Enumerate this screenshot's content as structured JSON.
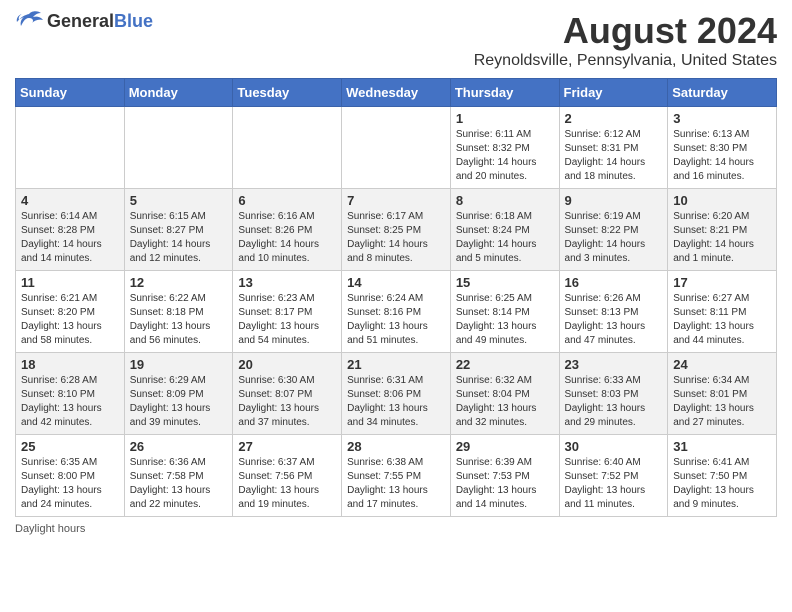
{
  "logo": {
    "general": "General",
    "blue": "Blue"
  },
  "title": "August 2024",
  "location": "Reynoldsville, Pennsylvania, United States",
  "days_of_week": [
    "Sunday",
    "Monday",
    "Tuesday",
    "Wednesday",
    "Thursday",
    "Friday",
    "Saturday"
  ],
  "weeks": [
    [
      {
        "day": "",
        "info": ""
      },
      {
        "day": "",
        "info": ""
      },
      {
        "day": "",
        "info": ""
      },
      {
        "day": "",
        "info": ""
      },
      {
        "day": "1",
        "info": "Sunrise: 6:11 AM\nSunset: 8:32 PM\nDaylight: 14 hours and 20 minutes."
      },
      {
        "day": "2",
        "info": "Sunrise: 6:12 AM\nSunset: 8:31 PM\nDaylight: 14 hours and 18 minutes."
      },
      {
        "day": "3",
        "info": "Sunrise: 6:13 AM\nSunset: 8:30 PM\nDaylight: 14 hours and 16 minutes."
      }
    ],
    [
      {
        "day": "4",
        "info": "Sunrise: 6:14 AM\nSunset: 8:28 PM\nDaylight: 14 hours and 14 minutes."
      },
      {
        "day": "5",
        "info": "Sunrise: 6:15 AM\nSunset: 8:27 PM\nDaylight: 14 hours and 12 minutes."
      },
      {
        "day": "6",
        "info": "Sunrise: 6:16 AM\nSunset: 8:26 PM\nDaylight: 14 hours and 10 minutes."
      },
      {
        "day": "7",
        "info": "Sunrise: 6:17 AM\nSunset: 8:25 PM\nDaylight: 14 hours and 8 minutes."
      },
      {
        "day": "8",
        "info": "Sunrise: 6:18 AM\nSunset: 8:24 PM\nDaylight: 14 hours and 5 minutes."
      },
      {
        "day": "9",
        "info": "Sunrise: 6:19 AM\nSunset: 8:22 PM\nDaylight: 14 hours and 3 minutes."
      },
      {
        "day": "10",
        "info": "Sunrise: 6:20 AM\nSunset: 8:21 PM\nDaylight: 14 hours and 1 minute."
      }
    ],
    [
      {
        "day": "11",
        "info": "Sunrise: 6:21 AM\nSunset: 8:20 PM\nDaylight: 13 hours and 58 minutes."
      },
      {
        "day": "12",
        "info": "Sunrise: 6:22 AM\nSunset: 8:18 PM\nDaylight: 13 hours and 56 minutes."
      },
      {
        "day": "13",
        "info": "Sunrise: 6:23 AM\nSunset: 8:17 PM\nDaylight: 13 hours and 54 minutes."
      },
      {
        "day": "14",
        "info": "Sunrise: 6:24 AM\nSunset: 8:16 PM\nDaylight: 13 hours and 51 minutes."
      },
      {
        "day": "15",
        "info": "Sunrise: 6:25 AM\nSunset: 8:14 PM\nDaylight: 13 hours and 49 minutes."
      },
      {
        "day": "16",
        "info": "Sunrise: 6:26 AM\nSunset: 8:13 PM\nDaylight: 13 hours and 47 minutes."
      },
      {
        "day": "17",
        "info": "Sunrise: 6:27 AM\nSunset: 8:11 PM\nDaylight: 13 hours and 44 minutes."
      }
    ],
    [
      {
        "day": "18",
        "info": "Sunrise: 6:28 AM\nSunset: 8:10 PM\nDaylight: 13 hours and 42 minutes."
      },
      {
        "day": "19",
        "info": "Sunrise: 6:29 AM\nSunset: 8:09 PM\nDaylight: 13 hours and 39 minutes."
      },
      {
        "day": "20",
        "info": "Sunrise: 6:30 AM\nSunset: 8:07 PM\nDaylight: 13 hours and 37 minutes."
      },
      {
        "day": "21",
        "info": "Sunrise: 6:31 AM\nSunset: 8:06 PM\nDaylight: 13 hours and 34 minutes."
      },
      {
        "day": "22",
        "info": "Sunrise: 6:32 AM\nSunset: 8:04 PM\nDaylight: 13 hours and 32 minutes."
      },
      {
        "day": "23",
        "info": "Sunrise: 6:33 AM\nSunset: 8:03 PM\nDaylight: 13 hours and 29 minutes."
      },
      {
        "day": "24",
        "info": "Sunrise: 6:34 AM\nSunset: 8:01 PM\nDaylight: 13 hours and 27 minutes."
      }
    ],
    [
      {
        "day": "25",
        "info": "Sunrise: 6:35 AM\nSunset: 8:00 PM\nDaylight: 13 hours and 24 minutes."
      },
      {
        "day": "26",
        "info": "Sunrise: 6:36 AM\nSunset: 7:58 PM\nDaylight: 13 hours and 22 minutes."
      },
      {
        "day": "27",
        "info": "Sunrise: 6:37 AM\nSunset: 7:56 PM\nDaylight: 13 hours and 19 minutes."
      },
      {
        "day": "28",
        "info": "Sunrise: 6:38 AM\nSunset: 7:55 PM\nDaylight: 13 hours and 17 minutes."
      },
      {
        "day": "29",
        "info": "Sunrise: 6:39 AM\nSunset: 7:53 PM\nDaylight: 13 hours and 14 minutes."
      },
      {
        "day": "30",
        "info": "Sunrise: 6:40 AM\nSunset: 7:52 PM\nDaylight: 13 hours and 11 minutes."
      },
      {
        "day": "31",
        "info": "Sunrise: 6:41 AM\nSunset: 7:50 PM\nDaylight: 13 hours and 9 minutes."
      }
    ]
  ],
  "footer": "Daylight hours"
}
